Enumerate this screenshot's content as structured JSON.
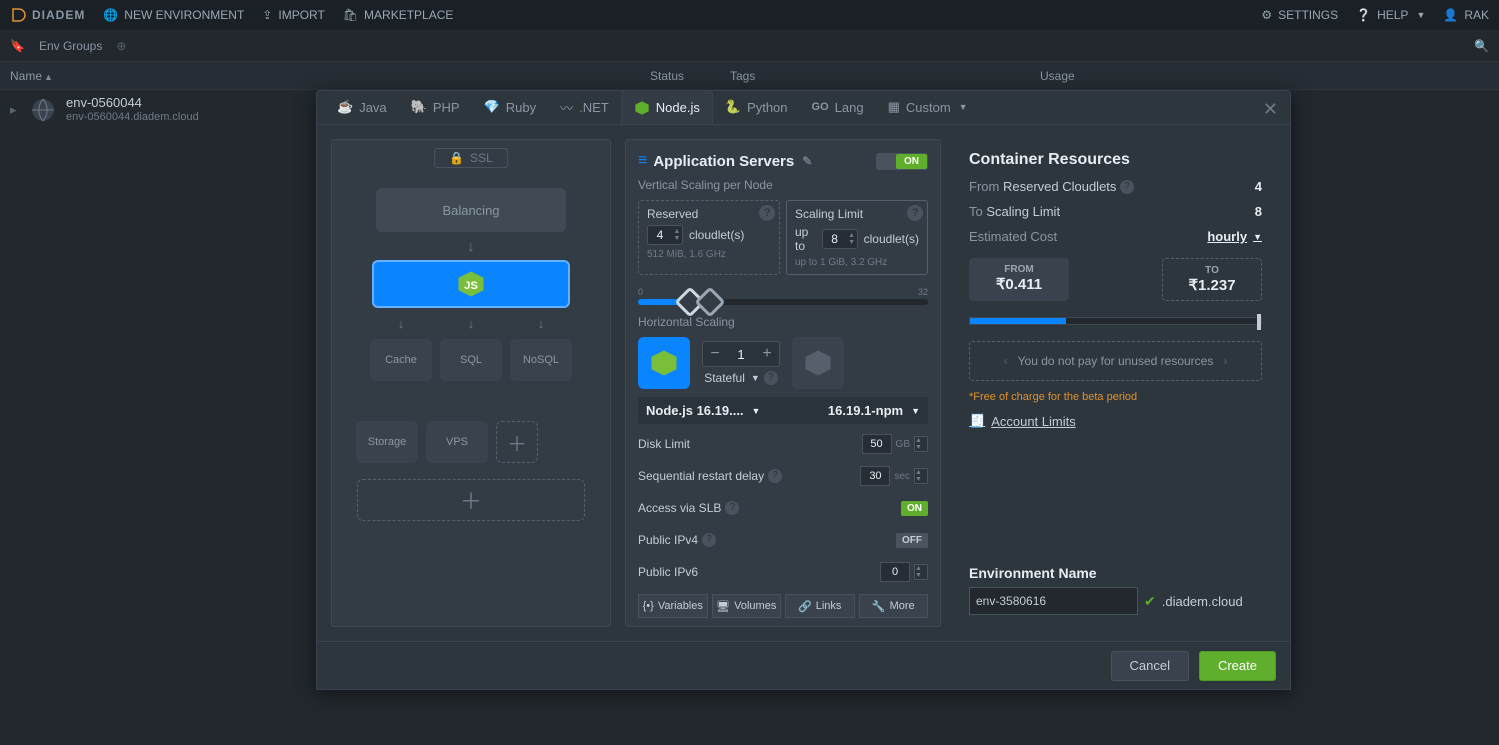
{
  "topbar": {
    "brand": "DIADEM",
    "new_env": "NEW ENVIRONMENT",
    "import": "IMPORT",
    "marketplace": "MARKETPLACE",
    "settings": "SETTINGS",
    "help": "HELP",
    "user": "RAK"
  },
  "subbar": {
    "env_groups": "Env Groups"
  },
  "columns": {
    "name": "Name",
    "status": "Status",
    "tags": "Tags",
    "usage": "Usage"
  },
  "envrow": {
    "name": "env-0560044",
    "host": "env-0560044.diadem.cloud"
  },
  "tabs": {
    "java": "Java",
    "php": "PHP",
    "ruby": "Ruby",
    "dotnet": ".NET",
    "nodejs": "Node.js",
    "python": "Python",
    "lang": "Lang",
    "custom": "Custom"
  },
  "topology": {
    "ssl": "SSL",
    "balancing": "Balancing",
    "cache": "Cache",
    "sql": "SQL",
    "nosql": "NoSQL",
    "storage": "Storage",
    "vps": "VPS"
  },
  "config": {
    "title": "Application Servers",
    "switch_on": "ON",
    "switch_off": "OFF",
    "vscale_label": "Vertical Scaling per Node",
    "reserved": {
      "title": "Reserved",
      "value": "4",
      "unit": "cloudlet(s)",
      "foot": "512 MiB, 1.6 GHz"
    },
    "limit": {
      "title": "Scaling Limit",
      "prefix": "up to",
      "value": "8",
      "unit": "cloudlet(s)",
      "foot_prefix": "up to",
      "foot": "1 GiB, 3.2 GHz"
    },
    "slider": {
      "min": "0",
      "max": "32"
    },
    "hscale_label": "Horizontal Scaling",
    "hcount": "1",
    "stateful": "Stateful",
    "version_short": "Node.js 16.19....",
    "version_tag": "16.19.1-npm",
    "disk_limit": {
      "label": "Disk Limit",
      "value": "50",
      "unit": "GB"
    },
    "restart": {
      "label": "Sequential restart delay",
      "value": "30",
      "unit": "sec"
    },
    "slb": {
      "label": "Access via SLB",
      "state": "ON"
    },
    "ipv4": {
      "label": "Public IPv4",
      "state": "OFF"
    },
    "ipv6": {
      "label": "Public IPv6",
      "value": "0"
    },
    "buttons": {
      "vars": "Variables",
      "vols": "Volumes",
      "links": "Links",
      "more": "More"
    }
  },
  "resources": {
    "title": "Container Resources",
    "from_label": "From",
    "from_bold": "Reserved Cloudlets",
    "from_val": "4",
    "to_label": "To",
    "to_bold": "Scaling Limit",
    "to_val": "8",
    "est_label": "Estimated Cost",
    "period": "hourly",
    "from_box": {
      "t": "FROM",
      "v": "₹0.411"
    },
    "to_box": {
      "t": "TO",
      "v": "₹1.237"
    },
    "hint": "You do not pay for unused resources",
    "free_note": "*Free of charge for the beta period",
    "acc_limits": "Account Limits",
    "env_name_label": "Environment Name",
    "env_name_value": "env-3580616",
    "domain": ".diadem.cloud"
  },
  "footer": {
    "cancel": "Cancel",
    "create": "Create"
  }
}
